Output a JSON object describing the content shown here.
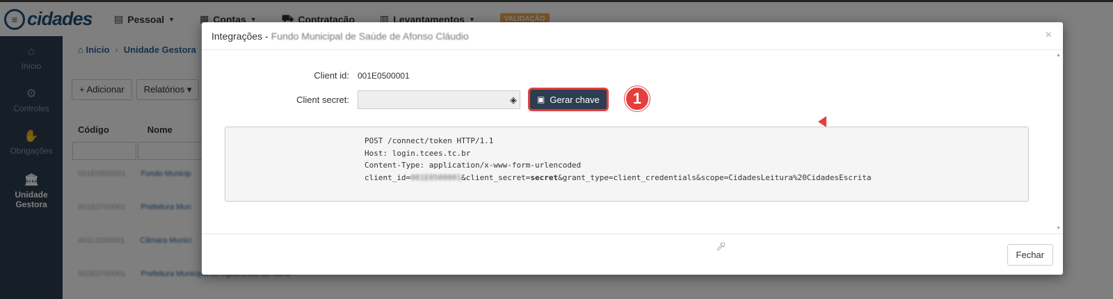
{
  "app": {
    "logo_text": "cidades",
    "nav": [
      {
        "label": "Pessoal"
      },
      {
        "label": "Contas"
      },
      {
        "label": "Contratação"
      },
      {
        "label": "Levantamentos"
      }
    ],
    "badge": "VALIDAÇÃO"
  },
  "sidebar": {
    "items": [
      {
        "label": "Início",
        "icon": "home-icon"
      },
      {
        "label": "Controles",
        "icon": "gear-icon"
      },
      {
        "label": "Obrigações",
        "icon": "handshake-icon"
      },
      {
        "label": "Unidade Gestora",
        "icon": "bank-icon"
      }
    ]
  },
  "breadcrumb": {
    "home": "Início",
    "current": "Unidade Gestora"
  },
  "toolbar": {
    "add": "Adicionar",
    "reports": "Relatórios"
  },
  "table": {
    "headers": [
      "Código",
      "Nome"
    ],
    "rows": [
      {
        "code": "001E0500001",
        "name": "Fundo Municip"
      },
      {
        "code": "001E0700001",
        "name": "Prefeitura Mun"
      },
      {
        "code": "001L0200001",
        "name": "Câmara Munici"
      },
      {
        "code": "002E0700001",
        "name": "Prefeitura Municipal de Água Doce do Norte"
      }
    ]
  },
  "modal": {
    "title": "Integrações -",
    "title_sub": "Fundo Municipal de Saúde de Afonso Cláudio",
    "client_id_label": "Client id:",
    "client_id_value": "001E0500001",
    "client_secret_label": "Client secret:",
    "generate_button": "Gerar chave",
    "marker": "1",
    "code": {
      "line1": "POST /connect/token HTTP/1.1",
      "line2": "Host: login.tcees.tc.br",
      "line3": "Content-Type: application/x-www-form-urlencoded",
      "line4_prefix": "client_id=",
      "line4_id": "001E0500001",
      "line4_mid": "&client_secret=",
      "line4_secret": "secret",
      "line4_suffix": "&grant_type=client_credentials&scope=CidadesLeitura%20CidadesEscrita"
    },
    "close_button": "Fechar"
  }
}
